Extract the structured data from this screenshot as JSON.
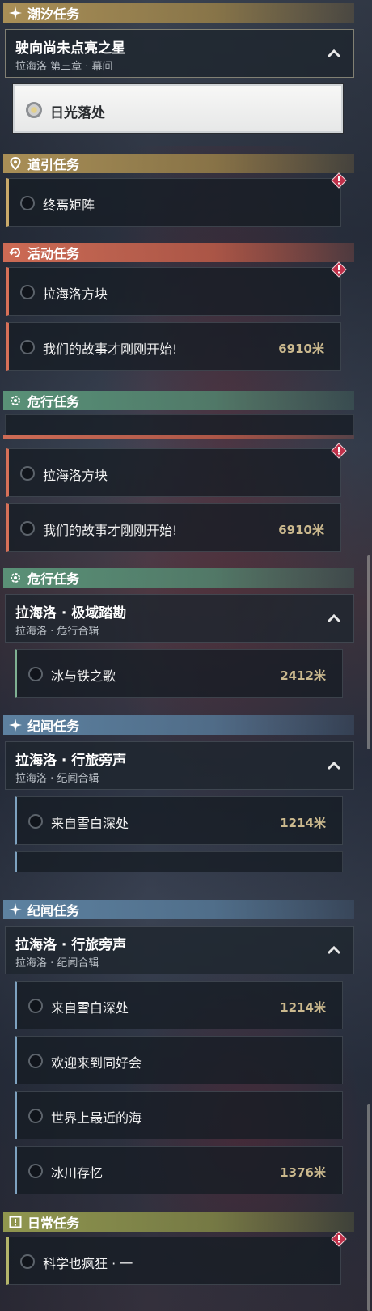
{
  "colors": {
    "tide_gold": "#b0945a",
    "guide_gold": "#b0945a",
    "event_orange": "#d66e56",
    "danger_green": "#5c967a",
    "chronicle_blue": "#6086a6",
    "daily_olive": "#969c50",
    "distance_text": "#cbb98e",
    "alert_red": "#c0304a"
  },
  "screen1": {
    "cat_tide": {
      "label": "潮汐任务",
      "icon": "sparkle-icon"
    },
    "group_tide": {
      "title": "驶向尚未点亮之星",
      "subtitle": "拉海洛 第三章 · 幕间",
      "icon": "chevron-up-icon"
    },
    "selected_task": {
      "label": "日光落处"
    },
    "cat_guide": {
      "label": "道引任务",
      "icon": "map-pin-icon"
    },
    "task_guide": {
      "label": "终焉矩阵",
      "alert_icon": "alert-diamond-icon"
    },
    "cat_event": {
      "label": "活动任务",
      "icon": "event-icon"
    },
    "task_event1": {
      "label": "拉海洛方块",
      "alert_icon": "alert-diamond-icon"
    },
    "task_event2": {
      "label": "我们的故事才刚刚开始!",
      "distance": "6910米"
    },
    "cat_danger": {
      "label": "危行任务",
      "icon": "danger-gear-icon"
    }
  },
  "screen2": {
    "task_event1": {
      "label": "拉海洛方块"
    },
    "task_event2": {
      "label": "我们的故事才刚刚开始!",
      "distance": "6910米"
    },
    "cat_danger": {
      "label": "危行任务"
    },
    "group_danger": {
      "title": "拉海洛 · 极域踏勘",
      "subtitle": "拉海洛 · 危行合辑"
    },
    "task_danger": {
      "label": "冰与铁之歌",
      "distance": "2412米"
    },
    "cat_chronicle": {
      "label": "纪闻任务",
      "icon": "sparkle-icon"
    },
    "group_chronicle": {
      "title": "拉海洛 · 行旅旁声",
      "subtitle": "拉海洛 · 纪闻合辑"
    },
    "task_chronicle": {
      "label": "来自雪白深处",
      "distance": "1214米"
    }
  },
  "screen3": {
    "cat_chronicle": {
      "label": "纪闻任务"
    },
    "group_chronicle": {
      "title": "拉海洛 · 行旅旁声",
      "subtitle": "拉海洛 · 纪闻合辑"
    },
    "tasks": [
      {
        "label": "来自雪白深处",
        "distance": "1214米"
      },
      {
        "label": "欢迎来到同好会",
        "distance": ""
      },
      {
        "label": "世界上最近的海",
        "distance": ""
      },
      {
        "label": "冰川存忆",
        "distance": "1376米"
      }
    ],
    "cat_daily": {
      "label": "日常任务",
      "icon": "exclamation-box-icon"
    },
    "task_daily": {
      "label": "科学也疯狂 · 一"
    }
  }
}
